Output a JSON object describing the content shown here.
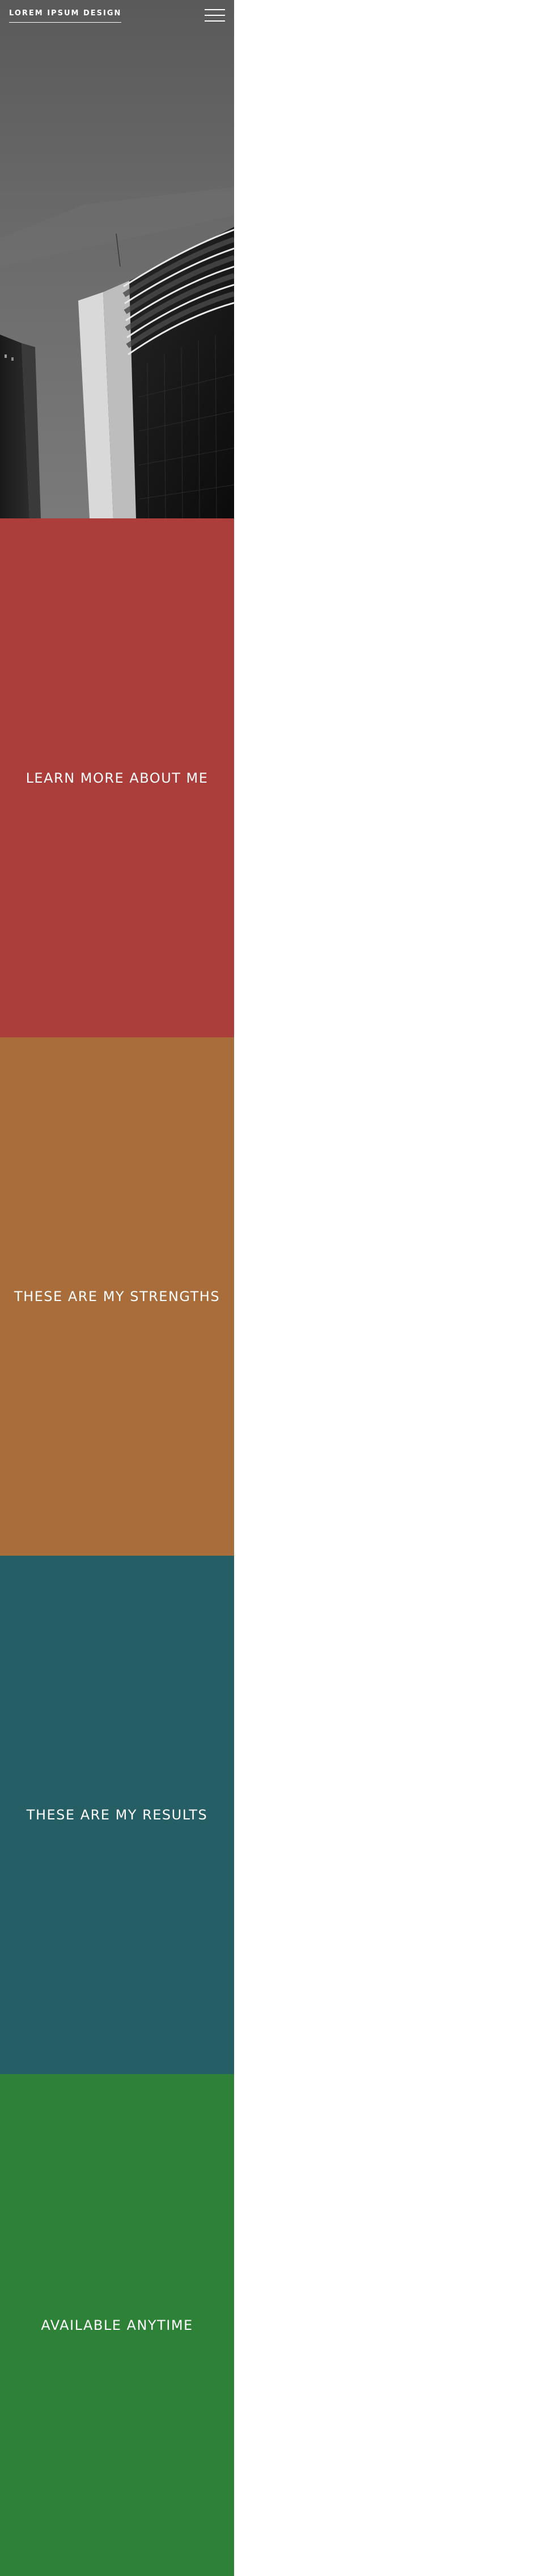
{
  "header": {
    "logo_text": "LOREM IPSUM DESIGN",
    "menu_icon": "hamburger-menu-icon"
  },
  "hero": {
    "image_subject": "black-and-white upward view of modern office buildings",
    "background_color": "#5e5e5e"
  },
  "sections": [
    {
      "id": "about",
      "title": "LEARN MORE ABOUT ME",
      "color": "#ab3d3b"
    },
    {
      "id": "strengths",
      "title": "THESE ARE MY STRENGTHS",
      "color": "#a86d3b"
    },
    {
      "id": "results",
      "title": "THESE ARE MY RESULTS",
      "color": "#265e66"
    },
    {
      "id": "available",
      "title": "AVAILABLE ANYTIME",
      "color": "#2d8237"
    }
  ]
}
